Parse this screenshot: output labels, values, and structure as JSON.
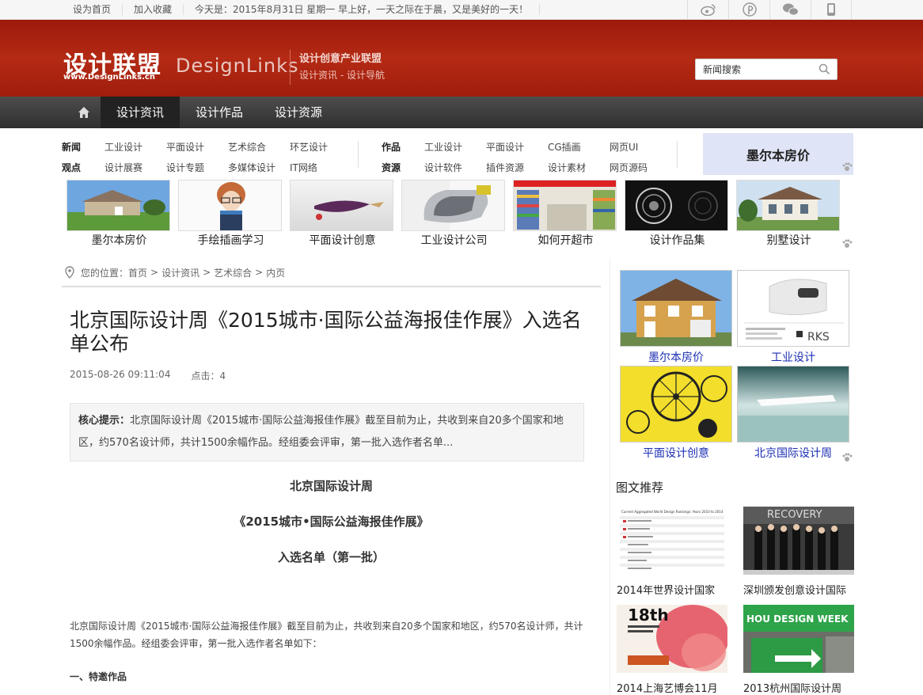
{
  "topbar": {
    "home": "设为首页",
    "fav": "加入收藏",
    "date": "今天是：2015年8月31日 星期一 早上好，一天之际在于晨，又是美好的一天！"
  },
  "header": {
    "logo_cn": "设计联盟",
    "logo_url": "www.DesignLinks.cn",
    "logo_en": "DesignLinks",
    "slogan1": "设计创意产业联盟",
    "slogan2": "设计资讯 - 设计导航",
    "search_value": "新闻搜索"
  },
  "nav": [
    "设计资讯",
    "设计作品",
    "设计资源"
  ],
  "subnav": {
    "g1": [
      {
        "h": "新闻",
        "links": [
          "工业设计",
          "平面设计",
          "艺术综合",
          "环艺设计"
        ]
      },
      {
        "h": "观点",
        "links": [
          "设计展赛",
          "设计专题",
          "多媒体设计",
          "IT网络"
        ]
      }
    ],
    "g2": [
      {
        "h": "作品",
        "links": [
          "工业设计",
          "平面设计",
          "CG插画",
          "网页UI"
        ]
      },
      {
        "h": "资源",
        "links": [
          "设计软件",
          "插件资源",
          "设计素材",
          "网页源码"
        ]
      }
    ],
    "ad": "墨尔本房价"
  },
  "thumbs": [
    "墨尔本房价",
    "手绘插画学习",
    "平面设计创意",
    "工业设计公司",
    "如何开超市",
    "设计作品集",
    "别墅设计"
  ],
  "crumb": [
    "您的位置：首页",
    ">",
    "设计资讯",
    ">",
    "艺术综合",
    ">",
    "内页"
  ],
  "article": {
    "title": "北京国际设计周《2015城市·国际公益海报佳作展》入选名单公布",
    "date": "2015-08-26 09:11:04",
    "hits": "点击：4",
    "summary_label": "核心提示：",
    "summary": "北京国际设计周《2015城市·国际公益海报佳作展》截至目前为止，共收到来自20多个国家和地区，约570名设计师，共计1500余幅作品。经组委会评审，第一批入选作者名单...",
    "h1": "北京国际设计周",
    "h2": "《2015城市•国际公益海报佳作展》",
    "h3": "入选名单（第一批）",
    "p1": "北京国际设计周《2015城市·国际公益海报佳作展》截至目前为止，共收到来自20多个国家和地区，约570名设计师，共计1500余幅作品。经组委会评审，第一批入选作者名单如下：",
    "sect1": "一、特邀作品"
  },
  "right": {
    "grid": [
      "墨尔本房价",
      "工业设计",
      "平面设计创意",
      "北京国际设计周"
    ],
    "rec_title": "图文推荐",
    "recs": [
      "2014年世界设计国家",
      "深圳颁发创意设计国际",
      "2014上海艺博会11月",
      "2013杭州国际设计周"
    ],
    "rec_img_text": [
      "Current Aggregated World Design Rankings: Years 2010 to 2014",
      "RECOVERY",
      "18th",
      "HOU DESIGN WEEK"
    ]
  },
  "colors": {
    "header_red": "#a82110",
    "nav_dark": "#3a3a3a",
    "link_blue": "#1b2fb3"
  }
}
